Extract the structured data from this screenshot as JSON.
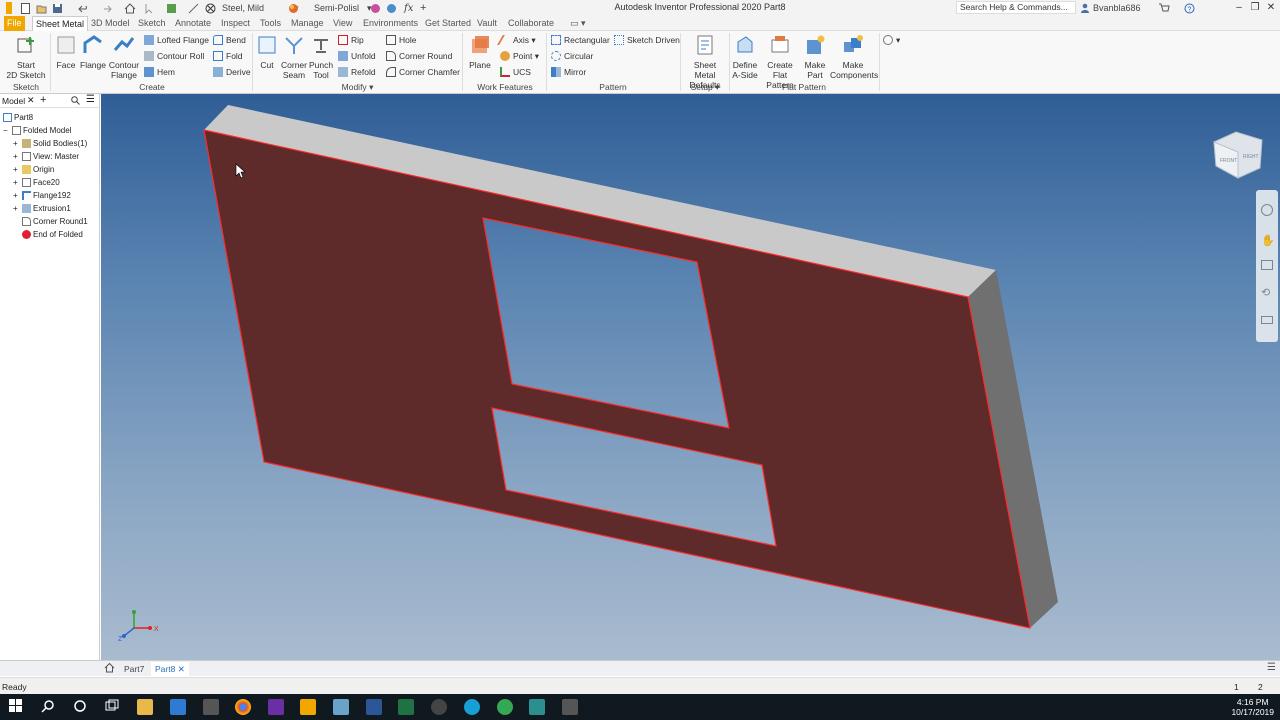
{
  "app": {
    "title": "Autodesk Inventor Professional 2020   Part8",
    "material": "Steel, Mild",
    "appearance": "Semi-Polisl",
    "search_placeholder": "Search Help & Commands...",
    "user": "Bvanbla686"
  },
  "tabs": [
    "File",
    "Sheet Metal",
    "3D Model",
    "Sketch",
    "Annotate",
    "Inspect",
    "Tools",
    "Manage",
    "View",
    "Environments",
    "Get Started",
    "Vault",
    "Collaborate"
  ],
  "ribbon": {
    "sketch": {
      "start_sketch": "Start",
      "start_sketch2": "2D Sketch",
      "label": "Sketch"
    },
    "create": {
      "face": "Face",
      "flange": "Flange",
      "contour": "Contour",
      "contour2": "Flange",
      "lofted_flange": "Lofted Flange",
      "contour_roll": "Contour Roll",
      "hem": "Hem",
      "bend": "Bend",
      "fold": "Fold",
      "derive": "Derive",
      "label": "Create"
    },
    "modify": {
      "cut": "Cut",
      "corner_seam": "Corner",
      "corner_seam2": "Seam",
      "punch_tool": "Punch",
      "punch_tool2": "Tool",
      "rip": "Rip",
      "unfold": "Unfold",
      "refold": "Refold",
      "hole": "Hole",
      "corner_round": "Corner Round",
      "corner_chamfer": "Corner Chamfer",
      "label": "Modify"
    },
    "work_features": {
      "plane": "Plane",
      "axis": "Axis",
      "point": "Point",
      "ucs": "UCS",
      "label": "Work Features"
    },
    "pattern": {
      "rectangular": "Rectangular",
      "circular": "Circular",
      "mirror": "Mirror",
      "sketch_driven": "Sketch Driven",
      "label": "Pattern"
    },
    "setup": {
      "defaults": "Sheet Metal",
      "defaults2": "Defaults",
      "label": "Setup"
    },
    "flat_pattern": {
      "define": "Define",
      "define2": "A-Side",
      "create": "Create",
      "create2": "Flat Pattern",
      "make_part": "Make",
      "make_part2": "Part",
      "make_comp": "Make",
      "make_comp2": "Components",
      "label": "Flat Pattern"
    }
  },
  "browser": {
    "tab": "Model",
    "items": [
      {
        "label": "Part8"
      },
      {
        "label": "Folded Model"
      },
      {
        "label": "Solid Bodies(1)"
      },
      {
        "label": "View: Master"
      },
      {
        "label": "Origin"
      },
      {
        "label": "Face20"
      },
      {
        "label": "Flange192"
      },
      {
        "label": "Extrusion1"
      },
      {
        "label": "Corner Round1"
      },
      {
        "label": "End of Folded"
      }
    ]
  },
  "viewcube": {
    "front": "FRONT",
    "right": "RIGHT"
  },
  "triad": {
    "x": "X",
    "y": "Y",
    "z": "Z"
  },
  "doc_tabs": [
    "Part7",
    "Part8"
  ],
  "status": {
    "text": "Ready",
    "count1": "1",
    "count2": "2"
  },
  "clock": {
    "time": "4:16 PM",
    "date": "10/17/2019"
  },
  "colors": {
    "selection": "#ff2a2a",
    "face": "#5e2a2a",
    "file_tab": "#f0a800",
    "viewport_top": "#2f5e96",
    "viewport_bottom": "#a9bbcf"
  }
}
